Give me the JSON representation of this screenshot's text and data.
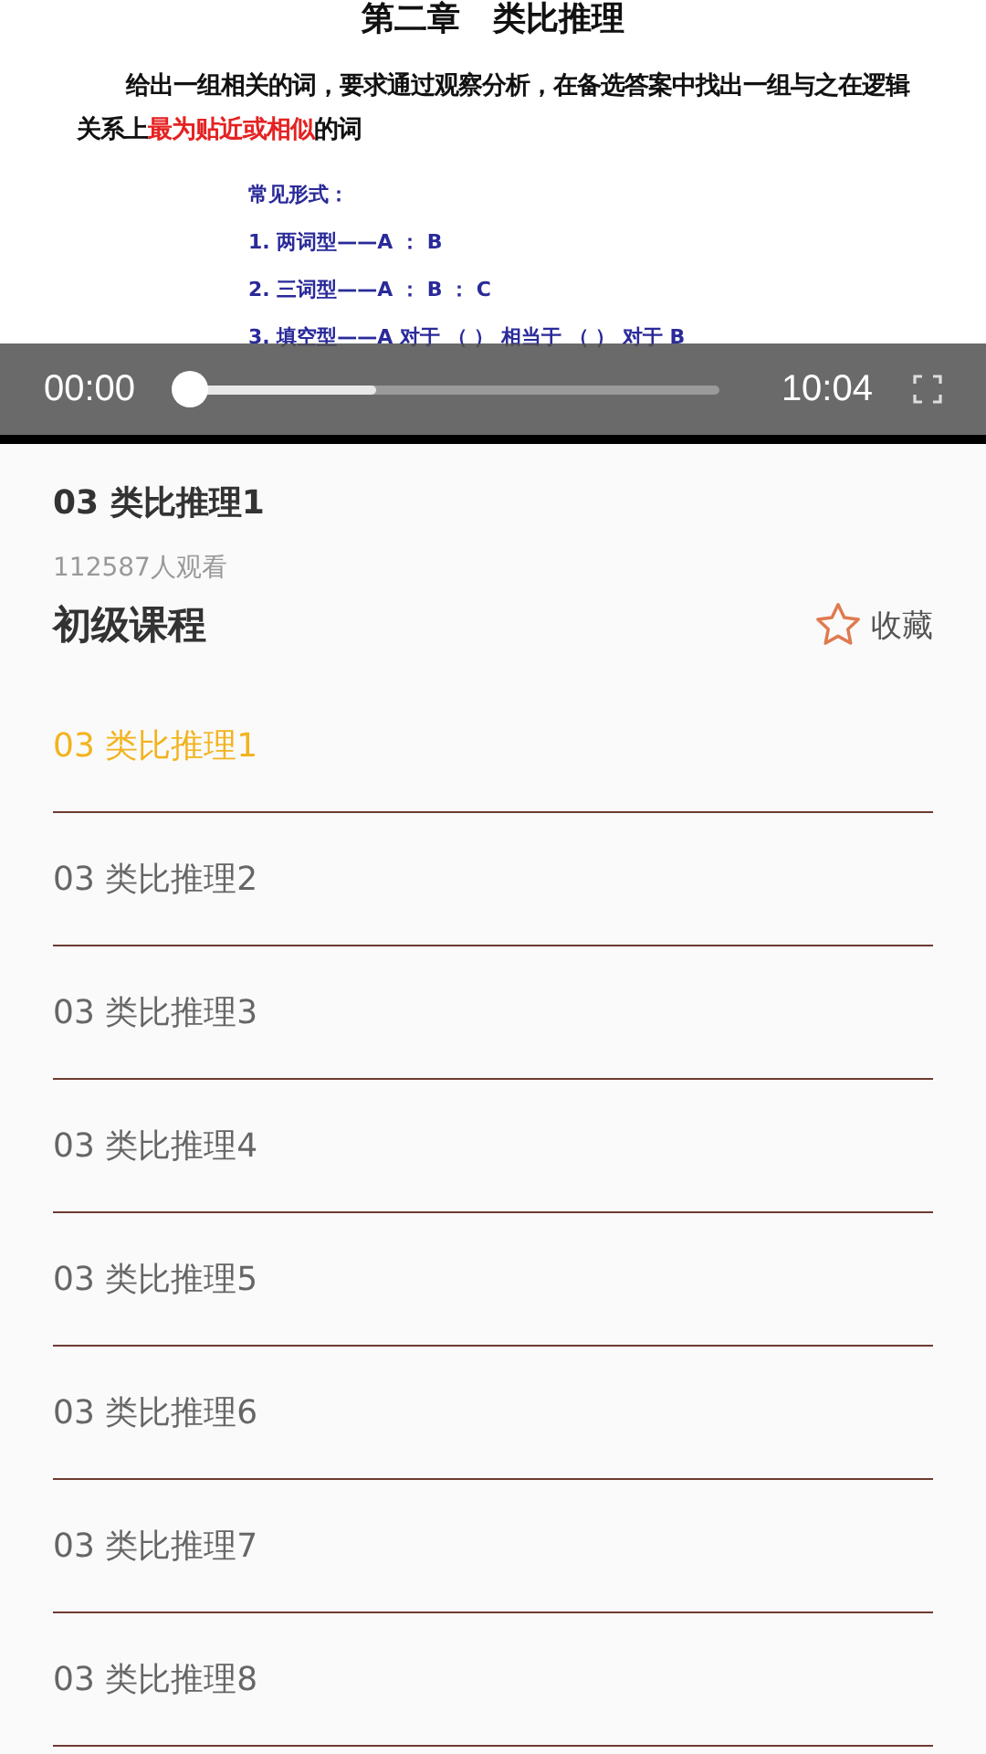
{
  "video": {
    "slide": {
      "title": "第二章　类比推理",
      "intro": "给出一组相关的词，要求通过观察分析，在备选答案中找出一组与之在逻辑关系上**最为贴近或相似**的词",
      "subhead": "常见形式：",
      "forms": [
        "1. 两词型——A ： B",
        "2. 三词型——A ： B ： C",
        "3. 填空型——A 对于 （ ） 相当于 （ ） 对于 B"
      ]
    },
    "controls": {
      "elapsed": "00:00",
      "duration": "10:04",
      "progress": {
        "level": 0
      },
      "buffer": {
        "level": 0.35
      }
    }
  },
  "lesson": {
    "title": "03 类比推理1",
    "views": "112587人观看"
  },
  "course": {
    "title": "初级课程",
    "favorite": {
      "label": "收藏",
      "checked": false
    }
  },
  "episodes": [
    {
      "title": "03 类比推理1",
      "selected": true
    },
    {
      "title": "03 类比推理2",
      "selected": false
    },
    {
      "title": "03 类比推理3",
      "selected": false
    },
    {
      "title": "03 类比推理4",
      "selected": false
    },
    {
      "title": "03 类比推理5",
      "selected": false
    },
    {
      "title": "03 类比推理6",
      "selected": false
    },
    {
      "title": "03 类比推理7",
      "selected": false
    },
    {
      "title": "03 类比推理8",
      "selected": false
    }
  ]
}
